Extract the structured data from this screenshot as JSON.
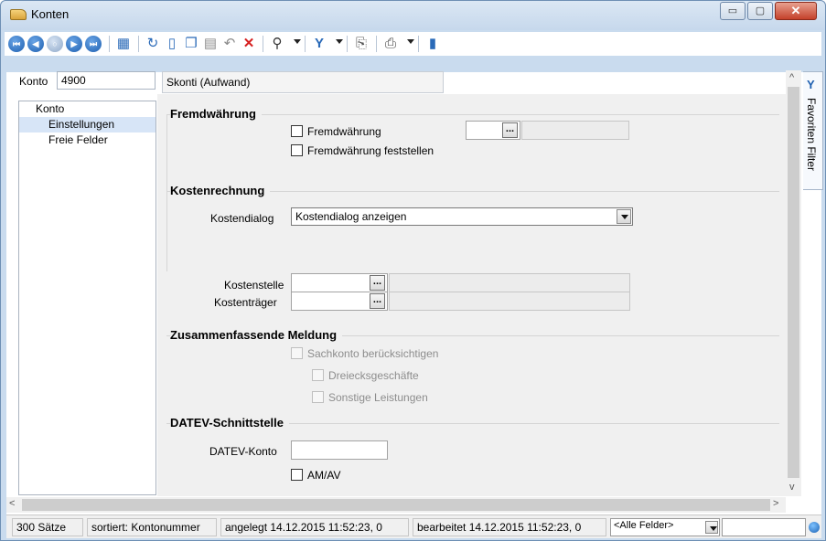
{
  "window": {
    "title": "Konten",
    "min_symbol": "▭",
    "max_symbol": "▢",
    "close_symbol": "✕"
  },
  "toolbar": {
    "nav_buttons": [
      {
        "name": "first-record-button",
        "glyph": "⏮"
      },
      {
        "name": "prev-record-button",
        "glyph": "◀"
      },
      {
        "name": "current-record-button",
        "glyph": "○"
      },
      {
        "name": "next-record-button",
        "glyph": "▶"
      },
      {
        "name": "last-record-button",
        "glyph": "⏭"
      }
    ],
    "icons": {
      "table": "▦",
      "refresh": "↻",
      "new": "▯",
      "copy": "❐",
      "save": "▤",
      "undo": "↶",
      "delete": "✕",
      "search": "⚲",
      "filter": "Y",
      "export": "⎘",
      "print": "⎙",
      "book": "▮"
    }
  },
  "header": {
    "konto_label": "Konto",
    "konto_value": "4900",
    "konto_description": "Skonti (Aufwand)"
  },
  "nav": {
    "items": [
      {
        "label": "Konto"
      },
      {
        "label": "Einstellungen"
      },
      {
        "label": "Freie Felder"
      }
    ]
  },
  "fremdwaehrung": {
    "title": "Fremdwährung",
    "checkbox_fremdwaehrung": "Fremdwährung",
    "checkbox_feststellen": "Fremdwährung feststellen",
    "currency_dots": "..."
  },
  "kostenrechnung": {
    "title": "Kostenrechnung",
    "kostendialog_label": "Kostendialog",
    "kostendialog_value": "Kostendialog anzeigen",
    "kostenstelle_label": "Kostenstelle",
    "kostentraeger_label": "Kostenträger",
    "dots": "..."
  },
  "zm": {
    "title": "Zusammenfassende Meldung",
    "sachkonto": "Sachkonto berücksichtigen",
    "dreiecks": "Dreiecksgeschäfte",
    "sonstige": "Sonstige Leistungen"
  },
  "datev": {
    "title": "DATEV-Schnittstelle",
    "konto_label": "DATEV-Konto",
    "konto_value": "",
    "amav": "AM/AV"
  },
  "sidetab": {
    "label": "Favoriten Filter",
    "icon": "Y"
  },
  "scroll": {
    "up": "^",
    "down": "v",
    "left": "<",
    "right": ">"
  },
  "status": {
    "count": "300 Sätze",
    "sort": "sortiert: Kontonummer",
    "created": "angelegt 14.12.2015 11:52:23,  0",
    "edited": "bearbeitet 14.12.2015 11:52:23, 0",
    "field_filter": "<Alle Felder>"
  }
}
